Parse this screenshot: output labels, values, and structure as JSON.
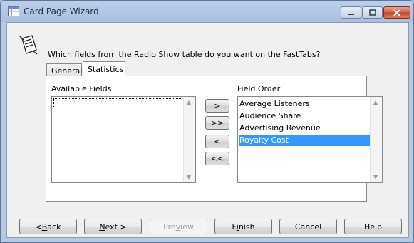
{
  "window": {
    "title": "Card Page Wizard"
  },
  "question": "Which fields from the Radio Show table do you want on the FastTabs?",
  "tabs": [
    {
      "label": "General",
      "active": false
    },
    {
      "label": "Statistics",
      "active": true
    }
  ],
  "available_fields": {
    "label": "Available Fields",
    "items": []
  },
  "field_order": {
    "label": "Field Order",
    "items": [
      "Average Listeners",
      "Audience Share",
      "Advertising Revenue",
      "Royalty Cost"
    ],
    "selected": "Royalty Cost"
  },
  "move_buttons": {
    "add": ">",
    "add_all": ">>",
    "remove": "<",
    "remove_all": "<<"
  },
  "buttons": {
    "back": {
      "pre": "< ",
      "accel": "B",
      "post": "ack"
    },
    "next": {
      "pre": "",
      "accel": "N",
      "post": "ext >"
    },
    "preview": {
      "pre": "Pre",
      "accel": "v",
      "post": "iew",
      "disabled": true
    },
    "finish": {
      "pre": "F",
      "accel": "i",
      "post": "nish"
    },
    "cancel": "Cancel",
    "help": "Help"
  },
  "colors": {
    "selection": "#3399ff",
    "close_button": "#c7432c"
  }
}
